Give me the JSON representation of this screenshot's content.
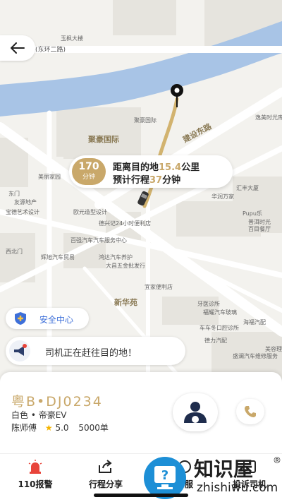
{
  "map": {
    "road_label_top": "(东环二路)",
    "labels": [
      {
        "text": "玉枫大楼"
      },
      {
        "text": "聚豪国际",
        "big": true
      },
      {
        "text": "聚豪国际"
      },
      {
        "text": "建设东路",
        "big": true
      },
      {
        "text": "新华苑",
        "big": true
      },
      {
        "text": "逸美时光库"
      },
      {
        "text": "汇丰大厦"
      },
      {
        "text": "华润万家"
      },
      {
        "text": "Pupu乐"
      },
      {
        "text": "普洱时光"
      },
      {
        "text": "百目餐厅"
      },
      {
        "text": "美丽家园"
      },
      {
        "text": "东门"
      },
      {
        "text": "友源地产"
      },
      {
        "text": "宝德艺术设计"
      },
      {
        "text": "欧元造型设计"
      },
      {
        "text": "德兴记24小时便利店"
      },
      {
        "text": "西北门"
      },
      {
        "text": "辉旭汽车贸易"
      },
      {
        "text": "百强汽车汽车服务中心"
      },
      {
        "text": "鸿达汽车养护"
      },
      {
        "text": "大昌五金批发行"
      },
      {
        "text": "宜家便利店"
      },
      {
        "text": "牙医诊所"
      },
      {
        "text": "福耀汽车玻璃"
      },
      {
        "text": "车车冬口腔诊所"
      },
      {
        "text": "德力汽配"
      },
      {
        "text": "海福汽配"
      },
      {
        "text": "美容理发"
      },
      {
        "text": "盛澜汽车维修服务"
      }
    ]
  },
  "trip": {
    "eta_minutes": "170",
    "eta_unit": "分钟",
    "distance_prefix": "距离目的地",
    "distance_value": "15.4",
    "distance_unit": "公里",
    "time_prefix": "预计行程",
    "time_value": "37",
    "time_unit": "分钟"
  },
  "safety": {
    "label": "安全中心"
  },
  "notice": {
    "text": "司机正在赶往目的地！"
  },
  "driver": {
    "plate": "粤B•DJ0234",
    "car": "白色 • 帝豪EV",
    "name": "陈师傅",
    "rating": "5.0",
    "orders": "5000单"
  },
  "actions": [
    {
      "label": "110报警",
      "icon": "alarm-icon"
    },
    {
      "label": "行程分享",
      "icon": "share-icon"
    },
    {
      "label": "客服",
      "icon": "service-icon"
    },
    {
      "label": "投诉司机",
      "icon": "complaint-icon"
    }
  ],
  "watermark": {
    "title": "知识屋",
    "url": "zhishiwu.com",
    "mark": "®"
  },
  "colors": {
    "accent": "#c9a86a",
    "river": "#a8c4e6",
    "alarm": "#e8443a",
    "safety": "#3d6fd9"
  }
}
